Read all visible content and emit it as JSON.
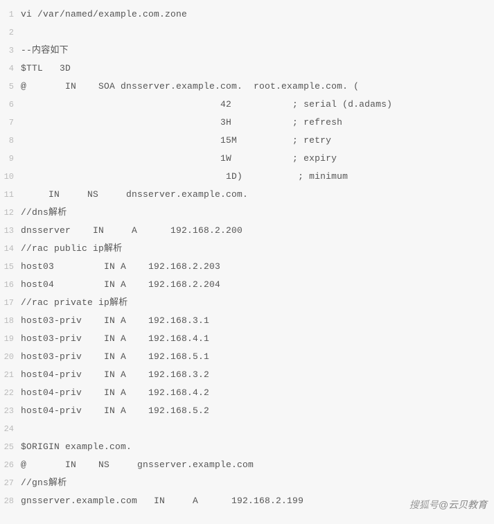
{
  "code": {
    "lines": [
      {
        "n": 1,
        "text": "vi /var/named/example.com.zone"
      },
      {
        "n": 2,
        "text": ""
      },
      {
        "n": 3,
        "text": "--内容如下"
      },
      {
        "n": 4,
        "text": "$TTL   3D"
      },
      {
        "n": 5,
        "text": "@       IN    SOA dnsserver.example.com.  root.example.com. ("
      },
      {
        "n": 6,
        "text": "                                    42           ; serial (d.adams)"
      },
      {
        "n": 7,
        "text": "                                    3H           ; refresh"
      },
      {
        "n": 8,
        "text": "                                    15M          ; retry"
      },
      {
        "n": 9,
        "text": "                                    1W           ; expiry"
      },
      {
        "n": 10,
        "text": "                                     1D)          ; minimum"
      },
      {
        "n": 11,
        "text": "     IN     NS     dnsserver.example.com."
      },
      {
        "n": 12,
        "text": "//dns解析"
      },
      {
        "n": 13,
        "text": "dnsserver    IN     A      192.168.2.200"
      },
      {
        "n": 14,
        "text": "//rac public ip解析"
      },
      {
        "n": 15,
        "text": "host03         IN A    192.168.2.203"
      },
      {
        "n": 16,
        "text": "host04         IN A    192.168.2.204"
      },
      {
        "n": 17,
        "text": "//rac private ip解析"
      },
      {
        "n": 18,
        "text": "host03-priv    IN A    192.168.3.1"
      },
      {
        "n": 19,
        "text": "host03-priv    IN A    192.168.4.1"
      },
      {
        "n": 20,
        "text": "host03-priv    IN A    192.168.5.1"
      },
      {
        "n": 21,
        "text": "host04-priv    IN A    192.168.3.2"
      },
      {
        "n": 22,
        "text": "host04-priv    IN A    192.168.4.2"
      },
      {
        "n": 23,
        "text": "host04-priv    IN A    192.168.5.2"
      },
      {
        "n": 24,
        "text": ""
      },
      {
        "n": 25,
        "text": "$ORIGIN example.com."
      },
      {
        "n": 26,
        "text": "@       IN    NS     gnsserver.example.com"
      },
      {
        "n": 27,
        "text": "//gns解析"
      },
      {
        "n": 28,
        "text": "gnsserver.example.com   IN     A      192.168.2.199"
      }
    ]
  },
  "watermark": {
    "prefix": "搜狐号",
    "at": "@",
    "name": "云贝教育"
  }
}
